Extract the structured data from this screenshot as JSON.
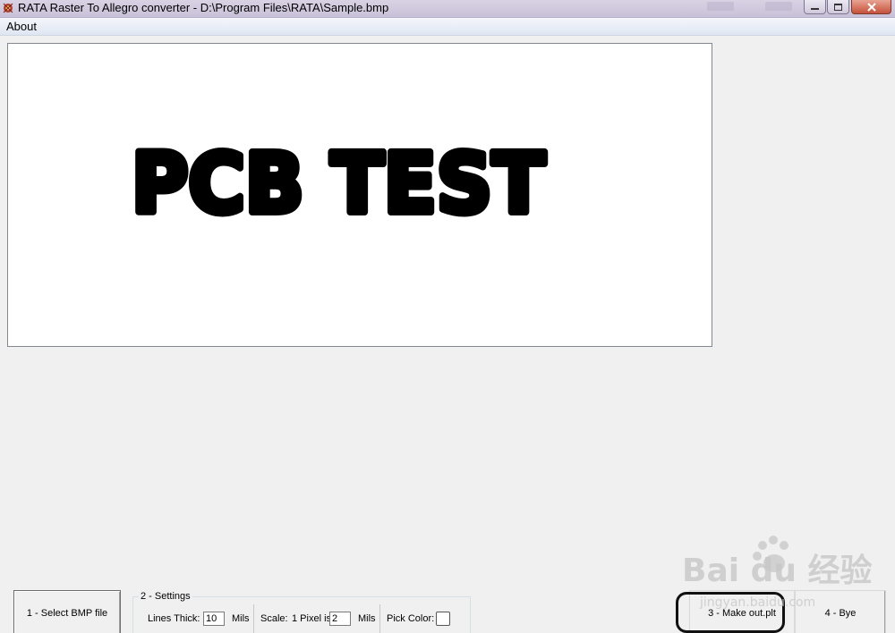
{
  "window": {
    "title": "RATA Raster To Allegro converter - D:\\Program Files\\RATA\\Sample.bmp",
    "controls": {
      "minimize": "–",
      "maximize": "□",
      "close": "✕"
    }
  },
  "menu": {
    "items": [
      {
        "label": "About"
      }
    ]
  },
  "canvas": {
    "image_text": "PCB TEST"
  },
  "buttons": {
    "select_bmp": "1 - Select BMP file",
    "make_out": "3 - Make out.plt",
    "bye": "4 - Bye"
  },
  "settings": {
    "legend": "2 - Settings",
    "lines_thick_label": "Lines Thick:",
    "lines_thick_value": "10",
    "lines_thick_unit": "Mils",
    "scale_label": "Scale:",
    "pixel_label": "1 Pixel is",
    "scale_value": "2",
    "scale_unit": "Mils",
    "pick_color_label": "Pick Color:"
  },
  "watermark": {
    "logo": "Bai du 经验",
    "url": "jingyan.baidu.com"
  },
  "colors": {
    "highlight_ring": "#111111",
    "canvas_bg": "#ffffff",
    "window_bg": "#f0f0f0"
  }
}
